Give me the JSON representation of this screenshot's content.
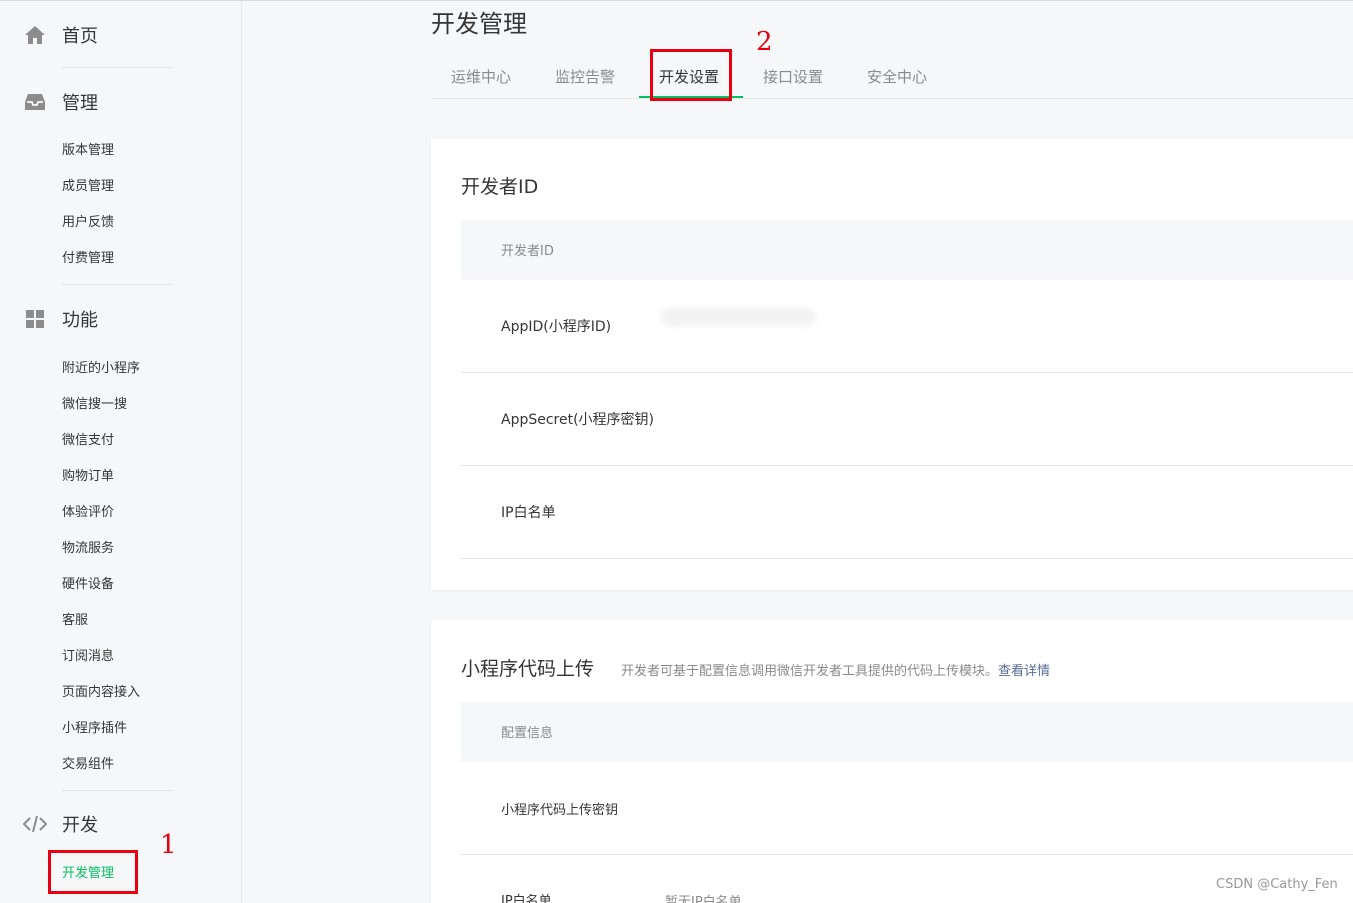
{
  "sidebar": {
    "home": {
      "label": "首页",
      "icon": "home-icon"
    },
    "manage": {
      "label": "管理",
      "icon": "inbox-icon",
      "items": [
        "版本管理",
        "成员管理",
        "用户反馈",
        "付费管理"
      ]
    },
    "features": {
      "label": "功能",
      "icon": "grid-icon",
      "items": [
        "附近的小程序",
        "微信搜一搜",
        "微信支付",
        "购物订单",
        "体验评价",
        "物流服务",
        "硬件设备",
        "客服",
        "订阅消息",
        "页面内容接入",
        "小程序插件",
        "交易组件"
      ]
    },
    "dev": {
      "label": "开发",
      "icon": "code-icon",
      "items": [
        "开发管理"
      ]
    }
  },
  "annotations": {
    "num1": "1",
    "num2": "2"
  },
  "page_title": "开发管理",
  "tabs": [
    "运维中心",
    "监控告警",
    "开发设置",
    "接口设置",
    "安全中心"
  ],
  "active_tab": "开发设置",
  "dev_id_card": {
    "title": "开发者ID",
    "table_header": "开发者ID",
    "rows": [
      {
        "key": "AppID(小程序ID)",
        "value": ""
      },
      {
        "key": "AppSecret(小程序密钥)",
        "value": ""
      },
      {
        "key": "IP白名单",
        "value": ""
      }
    ]
  },
  "upload_card": {
    "title": "小程序代码上传",
    "desc": "开发者可基于配置信息调用微信开发者工具提供的代码上传模块。",
    "link": "查看详情",
    "table_header": "配置信息",
    "rows": [
      {
        "key": "小程序代码上传密钥",
        "value": ""
      },
      {
        "key": "IP白名单",
        "value": "暂无IP白名单"
      }
    ]
  },
  "watermark": "CSDN @Cathy_Fen",
  "colors": {
    "accent": "#07c160",
    "annotation": "#e60012",
    "link": "#576b95"
  }
}
